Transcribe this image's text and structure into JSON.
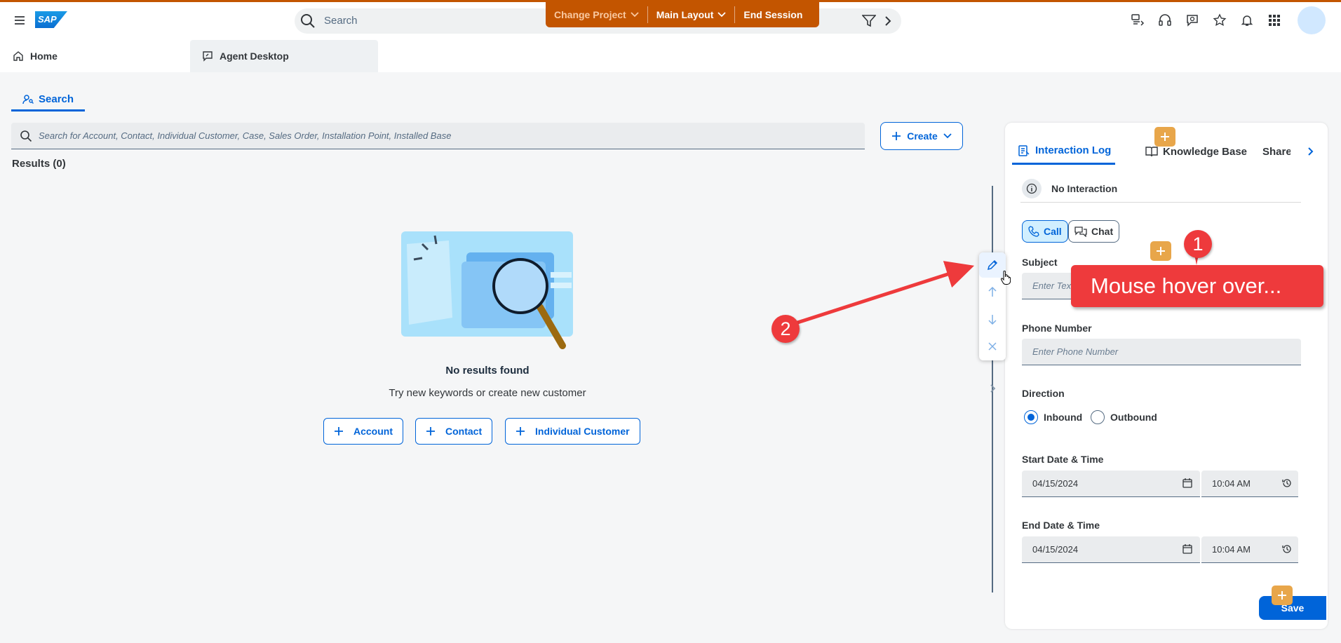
{
  "shell": {
    "logo": "SAP",
    "search_placeholder": "Search",
    "orange_bar": {
      "change_project": "Change Project",
      "main_layout": "Main Layout",
      "end_session": "End Session"
    }
  },
  "tabs": {
    "home": "Home",
    "agent_desktop": "Agent Desktop"
  },
  "search_panel": {
    "tab_label": "Search",
    "search_placeholder": "Search for Account, Contact, Individual Customer, Case, Sales Order, Installation Point, Installed Base",
    "create_label": "Create",
    "results_label": "Results (0)",
    "empty_title": "No results found",
    "empty_subtitle": "Try new keywords or create new customer",
    "quick_create": [
      "Account",
      "Contact",
      "Individual Customer"
    ]
  },
  "right_panel": {
    "tabs": [
      "Interaction Log",
      "Knowledge Base",
      "Share"
    ],
    "no_interaction": "No Interaction",
    "channel_buttons": [
      "Call",
      "Chat"
    ],
    "subject_label": "Subject",
    "subject_placeholder": "Enter Tex",
    "phone_label": "Phone Number",
    "phone_placeholder": "Enter Phone Number",
    "direction_label": "Direction",
    "direction_options": [
      "Inbound",
      "Outbound"
    ],
    "direction_selected": "Inbound",
    "start_label": "Start Date & Time",
    "start_date": "04/15/2024",
    "start_time": "10:04 AM",
    "end_label": "End Date & Time",
    "end_date": "04/15/2024",
    "end_time": "10:04 AM",
    "save_label": "Save"
  },
  "annotations": {
    "callout_text": "Mouse hover over...",
    "step1": "1",
    "step2": "2"
  },
  "colors": {
    "accent": "#0064d9",
    "shell_orange": "#c35500",
    "annotation_red": "#ee3a3c",
    "plus_badge": "#e8a64a"
  }
}
